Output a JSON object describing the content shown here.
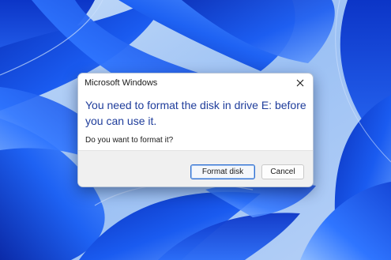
{
  "dialog": {
    "title": "Microsoft Windows",
    "heading": "You need to format the disk in drive E: before you can use it.",
    "message": "Do you want to format it?",
    "buttons": {
      "primary_label": "Format disk",
      "secondary_label": "Cancel"
    },
    "close_icon": "close-icon"
  },
  "colors": {
    "heading_text": "#1f3d9b",
    "primary_button_border": "#2f6fd0",
    "footer_background": "#f0f0f0",
    "wallpaper_blue": "#1a55e0"
  }
}
